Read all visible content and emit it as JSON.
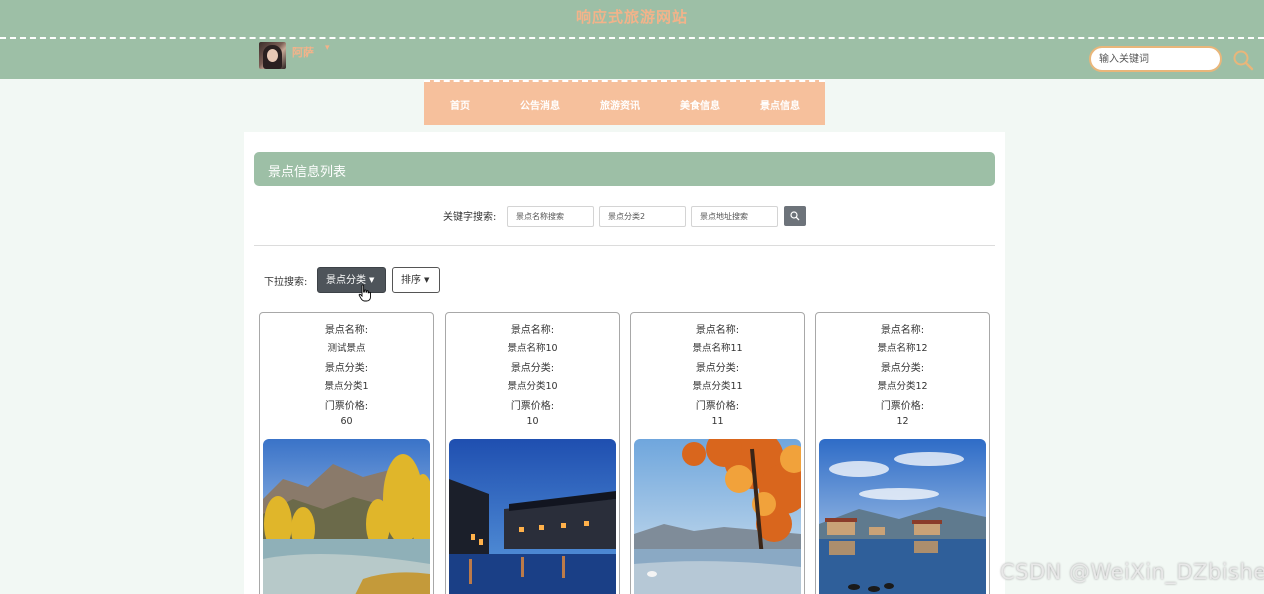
{
  "header": {
    "site_title": "响应式旅游网站",
    "username": "阿萨",
    "user_caret": "▾",
    "search_placeholder": "输入关键词"
  },
  "nav": {
    "items": [
      "首页",
      "公告消息",
      "旅游资讯",
      "美食信息",
      "景点信息"
    ]
  },
  "panel": {
    "title": "景点信息列表",
    "keyword_label": "关键字搜索:",
    "keyword_inputs": [
      "景点名称搜索",
      "景点分类2",
      "景点地址搜索"
    ],
    "dropdown_label": "下拉搜索:",
    "dropdown_category": "景点分类",
    "dropdown_sort": "排序"
  },
  "cards": [
    {
      "name_label": "景点名称:",
      "name": "测试景点",
      "category_label": "景点分类:",
      "category": "景点分类1",
      "price_label": "门票价格:",
      "price": "60"
    },
    {
      "name_label": "景点名称:",
      "name": "景点名称10",
      "category_label": "景点分类:",
      "category": "景点分类10",
      "price_label": "门票价格:",
      "price": "10"
    },
    {
      "name_label": "景点名称:",
      "name": "景点名称11",
      "category_label": "景点分类:",
      "category": "景点分类11",
      "price_label": "门票价格:",
      "price": "11"
    },
    {
      "name_label": "景点名称:",
      "name": "景点名称12",
      "category_label": "景点分类:",
      "category": "景点分类12",
      "price_label": "门票价格:",
      "price": "12"
    }
  ],
  "watermark": "CSDN @WeiXin_DZbishe",
  "colors": {
    "header_bg": "#9dbfa6",
    "accent_orange": "#f3b38a",
    "nav_bg": "#f6c09c",
    "dark_button": "#4e545a"
  }
}
